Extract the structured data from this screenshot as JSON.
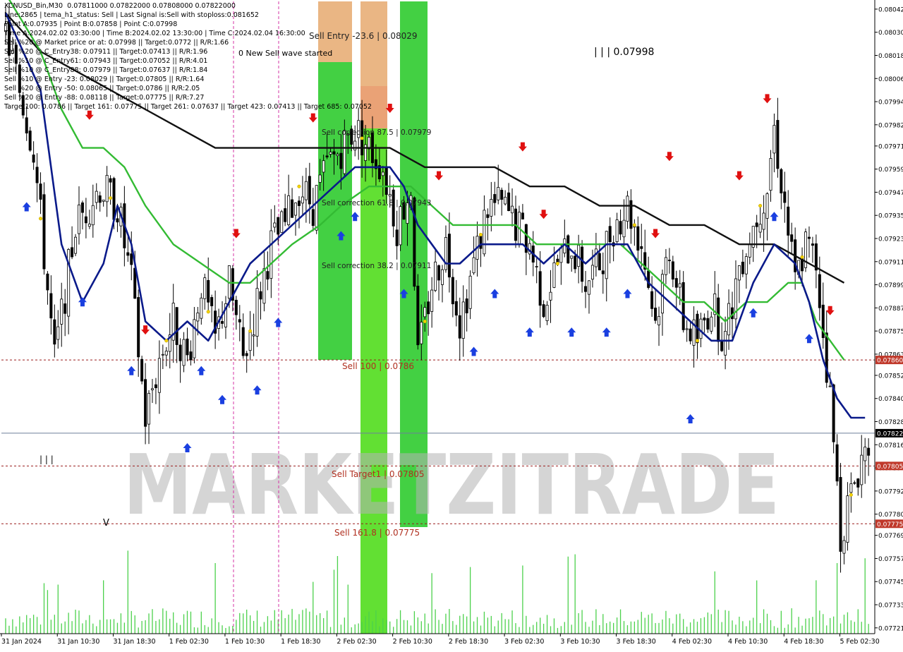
{
  "header": {
    "lines": [
      "XCNUSD_Bin,M30  0.07811000 0.07822000 0.07808000 0.07822000",
      "Line:2865 | tema_h1_status: Sell | Last Signal is:Sell with stoploss:0.081652",
      "Point A:0.07935 | Point B:0.07858 | Point C:0.07998",
      "Time A:2024.02.02 03:30:00 | Time B:2024.02.02 13:30:00 | Time C:2024.02.04 16:30:00",
      "Sell %20 @ Market price or at: 0.07998 || Target:0.0772 || R/R:1.66",
      "Sell %20 @ C_Entry38: 0.07911 || Target:0.07413 || R/R:1.96",
      "Sell %10 @ C_Entry61: 0.07943 || Target:0.07052 || R/R:4.01",
      "Sell %10 @ C_Entry88: 0.07979 || Target:0.07637 || R/R:1.84",
      "Sell %10 @ Entry -23: 0.08029 || Target:0.07805 || R/R:1.64",
      "Sell %20 @ Entry -50: 0.08065 || Target:0.0786 || R/R:2.05",
      "Sell %20 @ Entry -88: 0.08118 || Target:0.07775 || R/R:7.27",
      "Target100: 0.0786 || Target 161: 0.07775 || Target 261: 0.07637 || Target 423: 0.07413 || Target 685: 0.07052"
    ]
  },
  "annotations": {
    "wave_started": "0 New Sell wave started",
    "point_c_label": "| | | 0.07998",
    "wave_mark_left": "| | |",
    "wave_mark_v": "V",
    "entry_level": "Sell Entry -23.6 | 0.08029",
    "corr_875": "Sell correction 87.5 | 0.07979",
    "corr_618": "Sell correction 61.8 | 0.07943",
    "corr_382": "Sell correction 38.2 | 0.07911",
    "sell100": "Sell 100 | 0.0786",
    "target1": "Sell Target1 | 0.07805",
    "sell1618": "Sell 161.8 | 0.07775",
    "watermark": "MARKETZITRADE"
  },
  "chart_data": {
    "type": "candlestick",
    "symbol": "XCNUSD_Bin",
    "timeframe": "M30",
    "ylim": [
      0.07718,
      0.08046
    ],
    "price_axis_labels": [
      "0.08042",
      "0.08030",
      "0.08018",
      "0.08006",
      "0.07994",
      "0.07982",
      "0.07971",
      "0.07959",
      "0.07947",
      "0.07935",
      "0.07923",
      "0.07911",
      "0.07899",
      "0.07887",
      "0.07875",
      "0.07863",
      "0.07852",
      "0.07840",
      "0.07828",
      "0.07816",
      "0.07804",
      "0.07792",
      "0.07780",
      "0.07769",
      "0.07757",
      "0.07745",
      "0.07733",
      "0.07721"
    ],
    "price_axis_values": [
      0.08042,
      0.0803,
      0.08018,
      0.08006,
      0.07994,
      0.07982,
      0.07971,
      0.07959,
      0.07947,
      0.07935,
      0.07923,
      0.07911,
      0.07899,
      0.07887,
      0.07875,
      0.07863,
      0.07852,
      0.0784,
      0.07828,
      0.07816,
      0.07804,
      0.07792,
      0.0778,
      0.07769,
      0.07757,
      0.07745,
      0.07733,
      0.07721
    ],
    "time_labels": [
      "31 Jan 2024",
      "31 Jan 10:30",
      "31 Jan 18:30",
      "1 Feb 02:30",
      "1 Feb 10:30",
      "1 Feb 18:30",
      "2 Feb 02:30",
      "2 Feb 10:30",
      "2 Feb 18:30",
      "3 Feb 02:30",
      "3 Feb 10:30",
      "3 Feb 18:30",
      "4 Feb 02:30",
      "4 Feb 10:30",
      "4 Feb 18:30",
      "5 Feb 02:30"
    ],
    "time_label_slots": [
      0,
      16,
      32,
      48,
      64,
      80,
      96,
      112,
      128,
      144,
      160,
      176,
      192,
      208,
      224,
      240
    ],
    "current_price": "0.07822",
    "current_price_value": 0.07822,
    "price_markers": [
      {
        "label": "0.07860",
        "value": 0.0786,
        "color": "#c0392b"
      },
      {
        "label": "0.07805",
        "value": 0.07805,
        "color": "#c0392b"
      },
      {
        "label": "0.07775",
        "value": 0.07775,
        "color": "#c0392b"
      }
    ],
    "levels": [
      {
        "name": "Sell 100",
        "value": 0.0786
      },
      {
        "name": "Sell Target1",
        "value": 0.07805
      },
      {
        "name": "Sell 161.8",
        "value": 0.07775
      }
    ],
    "close_path": [
      [
        0,
        0.0803
      ],
      [
        8,
        0.0797
      ],
      [
        14,
        0.0786
      ],
      [
        20,
        0.0793
      ],
      [
        27,
        0.0795
      ],
      [
        32,
        0.0794
      ],
      [
        36,
        0.079
      ],
      [
        40,
        0.0783
      ],
      [
        44,
        0.0786
      ],
      [
        48,
        0.0788
      ],
      [
        52,
        0.0786
      ],
      [
        56,
        0.079
      ],
      [
        60,
        0.0787
      ],
      [
        64,
        0.079
      ],
      [
        68,
        0.0786
      ],
      [
        72,
        0.0789
      ],
      [
        76,
        0.0792
      ],
      [
        80,
        0.0793
      ],
      [
        84,
        0.0795
      ],
      [
        88,
        0.0794
      ],
      [
        92,
        0.0796
      ],
      [
        96,
        0.0797
      ],
      [
        100,
        0.0798
      ],
      [
        104,
        0.0797
      ],
      [
        108,
        0.0796
      ],
      [
        112,
        0.0793
      ],
      [
        116,
        0.0795
      ],
      [
        118,
        0.0786
      ],
      [
        122,
        0.079
      ],
      [
        126,
        0.0792
      ],
      [
        130,
        0.0788
      ],
      [
        134,
        0.0791
      ],
      [
        138,
        0.0794
      ],
      [
        142,
        0.0794
      ],
      [
        146,
        0.0793
      ],
      [
        150,
        0.0792
      ],
      [
        154,
        0.0789
      ],
      [
        158,
        0.0791
      ],
      [
        162,
        0.0792
      ],
      [
        166,
        0.079
      ],
      [
        170,
        0.0791
      ],
      [
        174,
        0.0793
      ],
      [
        178,
        0.0794
      ],
      [
        182,
        0.0792
      ],
      [
        186,
        0.0788
      ],
      [
        190,
        0.0792
      ],
      [
        194,
        0.0788
      ],
      [
        198,
        0.0787
      ],
      [
        202,
        0.0789
      ],
      [
        206,
        0.0787
      ],
      [
        210,
        0.0791
      ],
      [
        214,
        0.0793
      ],
      [
        218,
        0.0795
      ],
      [
        220,
        0.0798
      ],
      [
        223,
        0.0794
      ],
      [
        226,
        0.079
      ],
      [
        229,
        0.0792
      ],
      [
        232,
        0.0791
      ],
      [
        236,
        0.0784
      ],
      [
        239,
        0.0777
      ],
      [
        242,
        0.0779
      ],
      [
        245,
        0.0781
      ],
      [
        248,
        0.0782
      ]
    ],
    "ma_fast": [
      [
        0,
        0.0804
      ],
      [
        10,
        0.08
      ],
      [
        16,
        0.0792
      ],
      [
        22,
        0.0789
      ],
      [
        28,
        0.0791
      ],
      [
        32,
        0.0794
      ],
      [
        36,
        0.0792
      ],
      [
        40,
        0.0788
      ],
      [
        46,
        0.0787
      ],
      [
        52,
        0.0788
      ],
      [
        58,
        0.0787
      ],
      [
        64,
        0.0789
      ],
      [
        70,
        0.0791
      ],
      [
        76,
        0.0792
      ],
      [
        82,
        0.0793
      ],
      [
        88,
        0.0794
      ],
      [
        94,
        0.0795
      ],
      [
        100,
        0.0796
      ],
      [
        106,
        0.0796
      ],
      [
        110,
        0.0796
      ],
      [
        114,
        0.0795
      ],
      [
        118,
        0.0793
      ],
      [
        122,
        0.0792
      ],
      [
        126,
        0.0791
      ],
      [
        130,
        0.0791
      ],
      [
        136,
        0.0792
      ],
      [
        142,
        0.0792
      ],
      [
        148,
        0.0792
      ],
      [
        154,
        0.0791
      ],
      [
        160,
        0.0792
      ],
      [
        166,
        0.0791
      ],
      [
        172,
        0.0792
      ],
      [
        178,
        0.0792
      ],
      [
        184,
        0.079
      ],
      [
        190,
        0.0789
      ],
      [
        196,
        0.0788
      ],
      [
        202,
        0.0787
      ],
      [
        208,
        0.0787
      ],
      [
        214,
        0.079
      ],
      [
        220,
        0.0792
      ],
      [
        226,
        0.0791
      ],
      [
        230,
        0.0789
      ],
      [
        234,
        0.0786
      ],
      [
        238,
        0.0784
      ],
      [
        242,
        0.0783
      ],
      [
        246,
        0.0783
      ]
    ],
    "ma_mid": [
      [
        0,
        0.0805
      ],
      [
        10,
        0.0802
      ],
      [
        16,
        0.0799
      ],
      [
        22,
        0.0797
      ],
      [
        28,
        0.0797
      ],
      [
        34,
        0.0796
      ],
      [
        40,
        0.0794
      ],
      [
        48,
        0.0792
      ],
      [
        56,
        0.0791
      ],
      [
        64,
        0.079
      ],
      [
        70,
        0.079
      ],
      [
        76,
        0.0791
      ],
      [
        82,
        0.0792
      ],
      [
        90,
        0.0793
      ],
      [
        96,
        0.0794
      ],
      [
        104,
        0.0795
      ],
      [
        110,
        0.0795
      ],
      [
        116,
        0.0795
      ],
      [
        122,
        0.0794
      ],
      [
        128,
        0.0793
      ],
      [
        134,
        0.0793
      ],
      [
        140,
        0.0793
      ],
      [
        146,
        0.0793
      ],
      [
        152,
        0.0792
      ],
      [
        158,
        0.0792
      ],
      [
        164,
        0.0792
      ],
      [
        170,
        0.0792
      ],
      [
        176,
        0.0792
      ],
      [
        182,
        0.0791
      ],
      [
        188,
        0.079
      ],
      [
        194,
        0.0789
      ],
      [
        200,
        0.0789
      ],
      [
        206,
        0.0788
      ],
      [
        212,
        0.0789
      ],
      [
        218,
        0.0789
      ],
      [
        224,
        0.079
      ],
      [
        228,
        0.079
      ],
      [
        232,
        0.0788
      ],
      [
        236,
        0.0787
      ],
      [
        240,
        0.0786
      ]
    ],
    "ma_slow": [
      [
        0,
        0.0804
      ],
      [
        10,
        0.0802
      ],
      [
        20,
        0.0801
      ],
      [
        30,
        0.08
      ],
      [
        40,
        0.0799
      ],
      [
        50,
        0.0798
      ],
      [
        60,
        0.0797
      ],
      [
        70,
        0.0797
      ],
      [
        80,
        0.0797
      ],
      [
        90,
        0.0797
      ],
      [
        100,
        0.0797
      ],
      [
        110,
        0.0797
      ],
      [
        120,
        0.0796
      ],
      [
        130,
        0.0796
      ],
      [
        140,
        0.0796
      ],
      [
        150,
        0.0795
      ],
      [
        160,
        0.0795
      ],
      [
        170,
        0.0794
      ],
      [
        180,
        0.0794
      ],
      [
        190,
        0.0793
      ],
      [
        200,
        0.0793
      ],
      [
        210,
        0.0792
      ],
      [
        220,
        0.0792
      ],
      [
        230,
        0.0791
      ],
      [
        240,
        0.079
      ]
    ]
  }
}
